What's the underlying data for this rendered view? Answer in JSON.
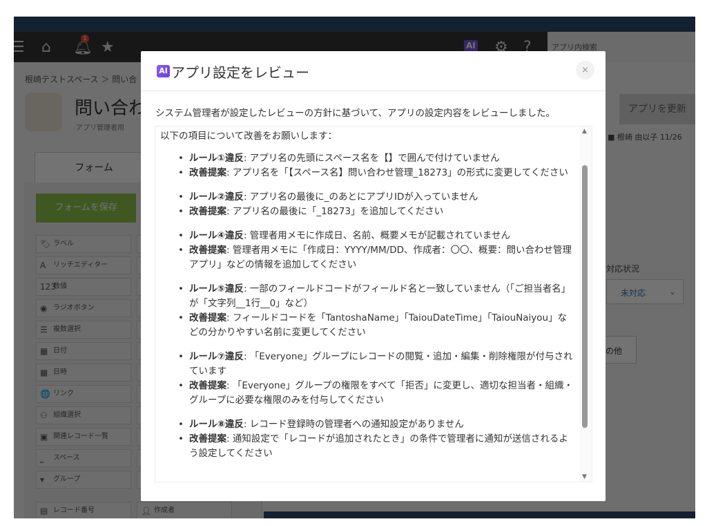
{
  "nav": {
    "notification_count": "1",
    "ai_label": "AI",
    "search_placeholder": "アプリ内検索"
  },
  "breadcrumb": "根崎テストスペース ＞ 問い合",
  "app": {
    "title": "問い合わ",
    "memo_link": "アプリ管理者用",
    "update_button": "アプリを更新",
    "last_editor": "根崎 由以子",
    "last_edit_date": "11/26"
  },
  "tabs": {
    "form": "フォーム"
  },
  "form": {
    "save_button": "フォームを保存",
    "palette": [
      {
        "icon": "tag-icon",
        "glyph": "🏷",
        "label": "ラベル"
      },
      {
        "icon": "rich-editor-icon",
        "glyph": "A",
        "label": "リッチエディター"
      },
      {
        "icon": "number-icon",
        "glyph": "123",
        "label": "数値"
      },
      {
        "icon": "radio-icon",
        "glyph": "◉",
        "label": "ラジオボタン"
      },
      {
        "icon": "multi-select-icon",
        "glyph": "☰",
        "label": "複数選択"
      },
      {
        "icon": "date-icon",
        "glyph": "▦",
        "label": "日付"
      },
      {
        "icon": "datetime-icon",
        "glyph": "▦",
        "label": "日時"
      },
      {
        "icon": "link-icon",
        "glyph": "🌐",
        "label": "リンク"
      },
      {
        "icon": "org-icon",
        "glyph": "⚇",
        "label": "組織選択"
      },
      {
        "icon": "related-records-icon",
        "glyph": "▣",
        "label": "関連レコード一覧"
      },
      {
        "icon": "space-icon",
        "glyph": "⎵",
        "label": "スペース"
      },
      {
        "icon": "group-icon",
        "glyph": "▾",
        "label": "グループ"
      }
    ],
    "record_number": "レコード番号",
    "creator": "作成者"
  },
  "right": {
    "status_label": "対応状況",
    "status_value": "未対応",
    "other": "の他"
  },
  "modal": {
    "ai_badge": "AI",
    "title": "アプリ設定をレビュー",
    "close": "×",
    "subtitle": "システム管理者が設定したレビューの方針に基づいて、アプリの設定内容をレビューしました。",
    "intro": "以下の項目について改善をお願いします：",
    "items": [
      {
        "rule": "ルール①違反",
        "rule_text": ": アプリ名の先頭にスペース名を【】で囲んで付けていません",
        "fix": "改善提案",
        "fix_text": ": アプリ名を「【スペース名】問い合わせ管理_18273」の形式に変更してください"
      },
      {
        "rule": "ルール②違反",
        "rule_text": ": アプリ名の最後に_のあとにアプリIDが入っていません",
        "fix": "改善提案",
        "fix_text": ": アプリ名の最後に「_18273」を追加してください"
      },
      {
        "rule": "ルール④違反",
        "rule_text": ": 管理者用メモに作成日、名前、概要メモが記載されていません",
        "fix": "改善提案",
        "fix_text": ": 管理者用メモに「作成日：YYYY/MM/DD、作成者：〇〇、概要：問い合わせ管理アプリ」などの情報を追加してください"
      },
      {
        "rule": "ルール⑤違反",
        "rule_text": ": 一部のフィールドコードがフィールド名と一致していません（「ご担当者名」が「文字列__1行__0」など）",
        "fix": "改善提案",
        "fix_text": ": フィールドコードを「TantoshaName」「TaiouDateTime」「TaiouNaiyou」などの分かりやすい名前に変更してください"
      },
      {
        "rule": "ルール⑦違反",
        "rule_text": ": 「Everyone」グループにレコードの閲覧・追加・編集・削除権限が付与されています",
        "fix": "改善提案",
        "fix_text": ": 「Everyone」グループの権限をすべて「拒否」に変更し、適切な担当者・組織・グループに必要な権限のみを付与してください"
      },
      {
        "rule": "ルール⑧違反",
        "rule_text": ": レコード登録時の管理者への通知設定がありません",
        "fix": "改善提案",
        "fix_text": ": 通知設定で「レコードが追加されたとき」の条件で管理者に通知が送信されるよう設定してください"
      }
    ]
  }
}
